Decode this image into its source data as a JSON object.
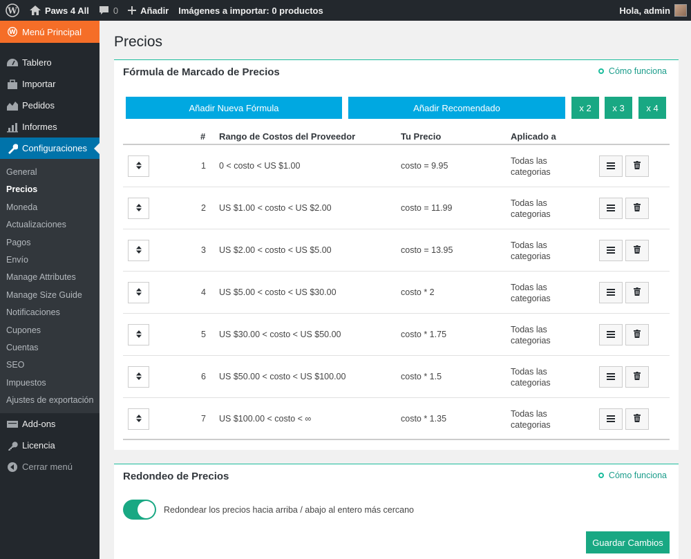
{
  "adminbar": {
    "site_name": "Paws 4 All",
    "comments_count": "0",
    "add_new": "Añadir",
    "import_status": "Imágenes a importar: 0 productos",
    "greeting": "Hola, admin"
  },
  "sidebar": {
    "main_menu": "Menú Principal",
    "items": [
      {
        "label": "Tablero",
        "icon": "dashboard-icon"
      },
      {
        "label": "Importar",
        "icon": "import-icon"
      },
      {
        "label": "Pedidos",
        "icon": "orders-icon"
      },
      {
        "label": "Informes",
        "icon": "reports-icon"
      },
      {
        "label": "Configuraciones",
        "icon": "wrench-icon"
      }
    ],
    "submenu": [
      "General",
      "Precios",
      "Moneda",
      "Actualizaciones",
      "Pagos",
      "Envío",
      "Manage Attributes",
      "Manage Size Guide",
      "Notificaciones",
      "Cupones",
      "Cuentas",
      "SEO",
      "Impuestos",
      "Ajustes de exportación"
    ],
    "bottom_items": [
      {
        "label": "Add-ons",
        "icon": "addons-icon"
      },
      {
        "label": "Licencia",
        "icon": "key-icon"
      }
    ],
    "collapse": "Cerrar menú"
  },
  "page": {
    "title": "Precios"
  },
  "markup_panel": {
    "title": "Fórmula de Marcado de Precios",
    "how_it_works": "Cómo funciona",
    "add_formula": "Añadir Nueva Fórmula",
    "add_recommended": "Añadir Recomendado",
    "multipliers": [
      "x 2",
      "x 3",
      "x 4"
    ],
    "columns": {
      "num": "#",
      "range": "Rango de Costos del Proveedor",
      "price": "Tu Precio",
      "applied": "Aplicado a"
    },
    "rows": [
      {
        "num": "1",
        "range": "0 < costo < US $1.00",
        "price": "costo = 9.95",
        "applied": "Todas las categorias"
      },
      {
        "num": "2",
        "range": "US $1.00 < costo < US $2.00",
        "price": "costo = 11.99",
        "applied": "Todas las categorias"
      },
      {
        "num": "3",
        "range": "US $2.00 < costo < US $5.00",
        "price": "costo = 13.95",
        "applied": "Todas las categorias"
      },
      {
        "num": "4",
        "range": "US $5.00 < costo < US $30.00",
        "price": "costo * 2",
        "applied": "Todas las categorias"
      },
      {
        "num": "5",
        "range": "US $30.00 < costo < US $50.00",
        "price": "costo * 1.75",
        "applied": "Todas las categorias"
      },
      {
        "num": "6",
        "range": "US $50.00 < costo < US $100.00",
        "price": "costo * 1.5",
        "applied": "Todas las categorias"
      },
      {
        "num": "7",
        "range": "US $100.00 < costo < ∞",
        "price": "costo * 1.35",
        "applied": "Todas las categorias"
      }
    ]
  },
  "rounding_panel": {
    "title": "Redondeo de Precios",
    "how_it_works": "Cómo funciona",
    "toggle_label": "Redondear los precios hacia arriba / abajo al entero más cercano",
    "toggle_on": true,
    "save": "Guardar Cambios"
  },
  "colors": {
    "accent_blue": "#00a8e1",
    "accent_green": "#19a883",
    "menu_orange": "#f56e28",
    "menu_active": "#0073aa"
  }
}
